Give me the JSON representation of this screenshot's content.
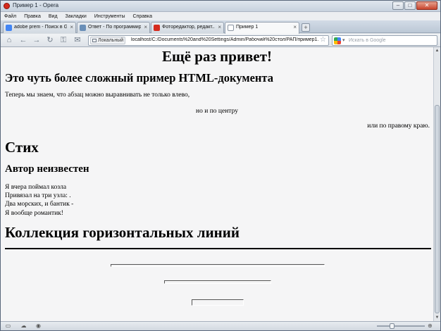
{
  "window": {
    "title": "Пример 1 - Opera"
  },
  "menu": [
    "Файл",
    "Правка",
    "Вид",
    "Закладки",
    "Инструменты",
    "Справка"
  ],
  "tabs": [
    {
      "label": "adobe prem - Поиск в G...",
      "icon": "google-icon",
      "color": "#4285f4"
    },
    {
      "label": "Ответ - По программир...",
      "icon": "page-icon",
      "color": "#6a8fb8"
    },
    {
      "label": "Фоторедактор, редакт...",
      "icon": "adobe-icon",
      "color": "#d52b1e"
    },
    {
      "label": "Пример 1",
      "icon": "document-icon",
      "color": "#ffffff"
    }
  ],
  "address": {
    "badge": "Локальный",
    "url": "localhost/C:/Documents%20and%20Settings/Admin/Рабочий%20стол/РАП/пример1.htm"
  },
  "search": {
    "placeholder": "Искать в Google"
  },
  "page": {
    "h1": "Ещё раз привет!",
    "h2": "Это чуть более сложный пример HTML-документа",
    "p_left": "Теперь мы знаем, что абзац можно выравнивать не только влево,",
    "p_center": "но и по центру",
    "p_right": "или по правому краю.",
    "poem_heading": "Стих",
    "author": "Автор неизвестен",
    "poem_lines": [
      "Я вчера поймал козла",
      "Привязал на три узла: .",
      "Два морских, и бантик -",
      "Я вообще романтик!"
    ],
    "hr_heading": "Коллекция горизонтальных линий"
  }
}
